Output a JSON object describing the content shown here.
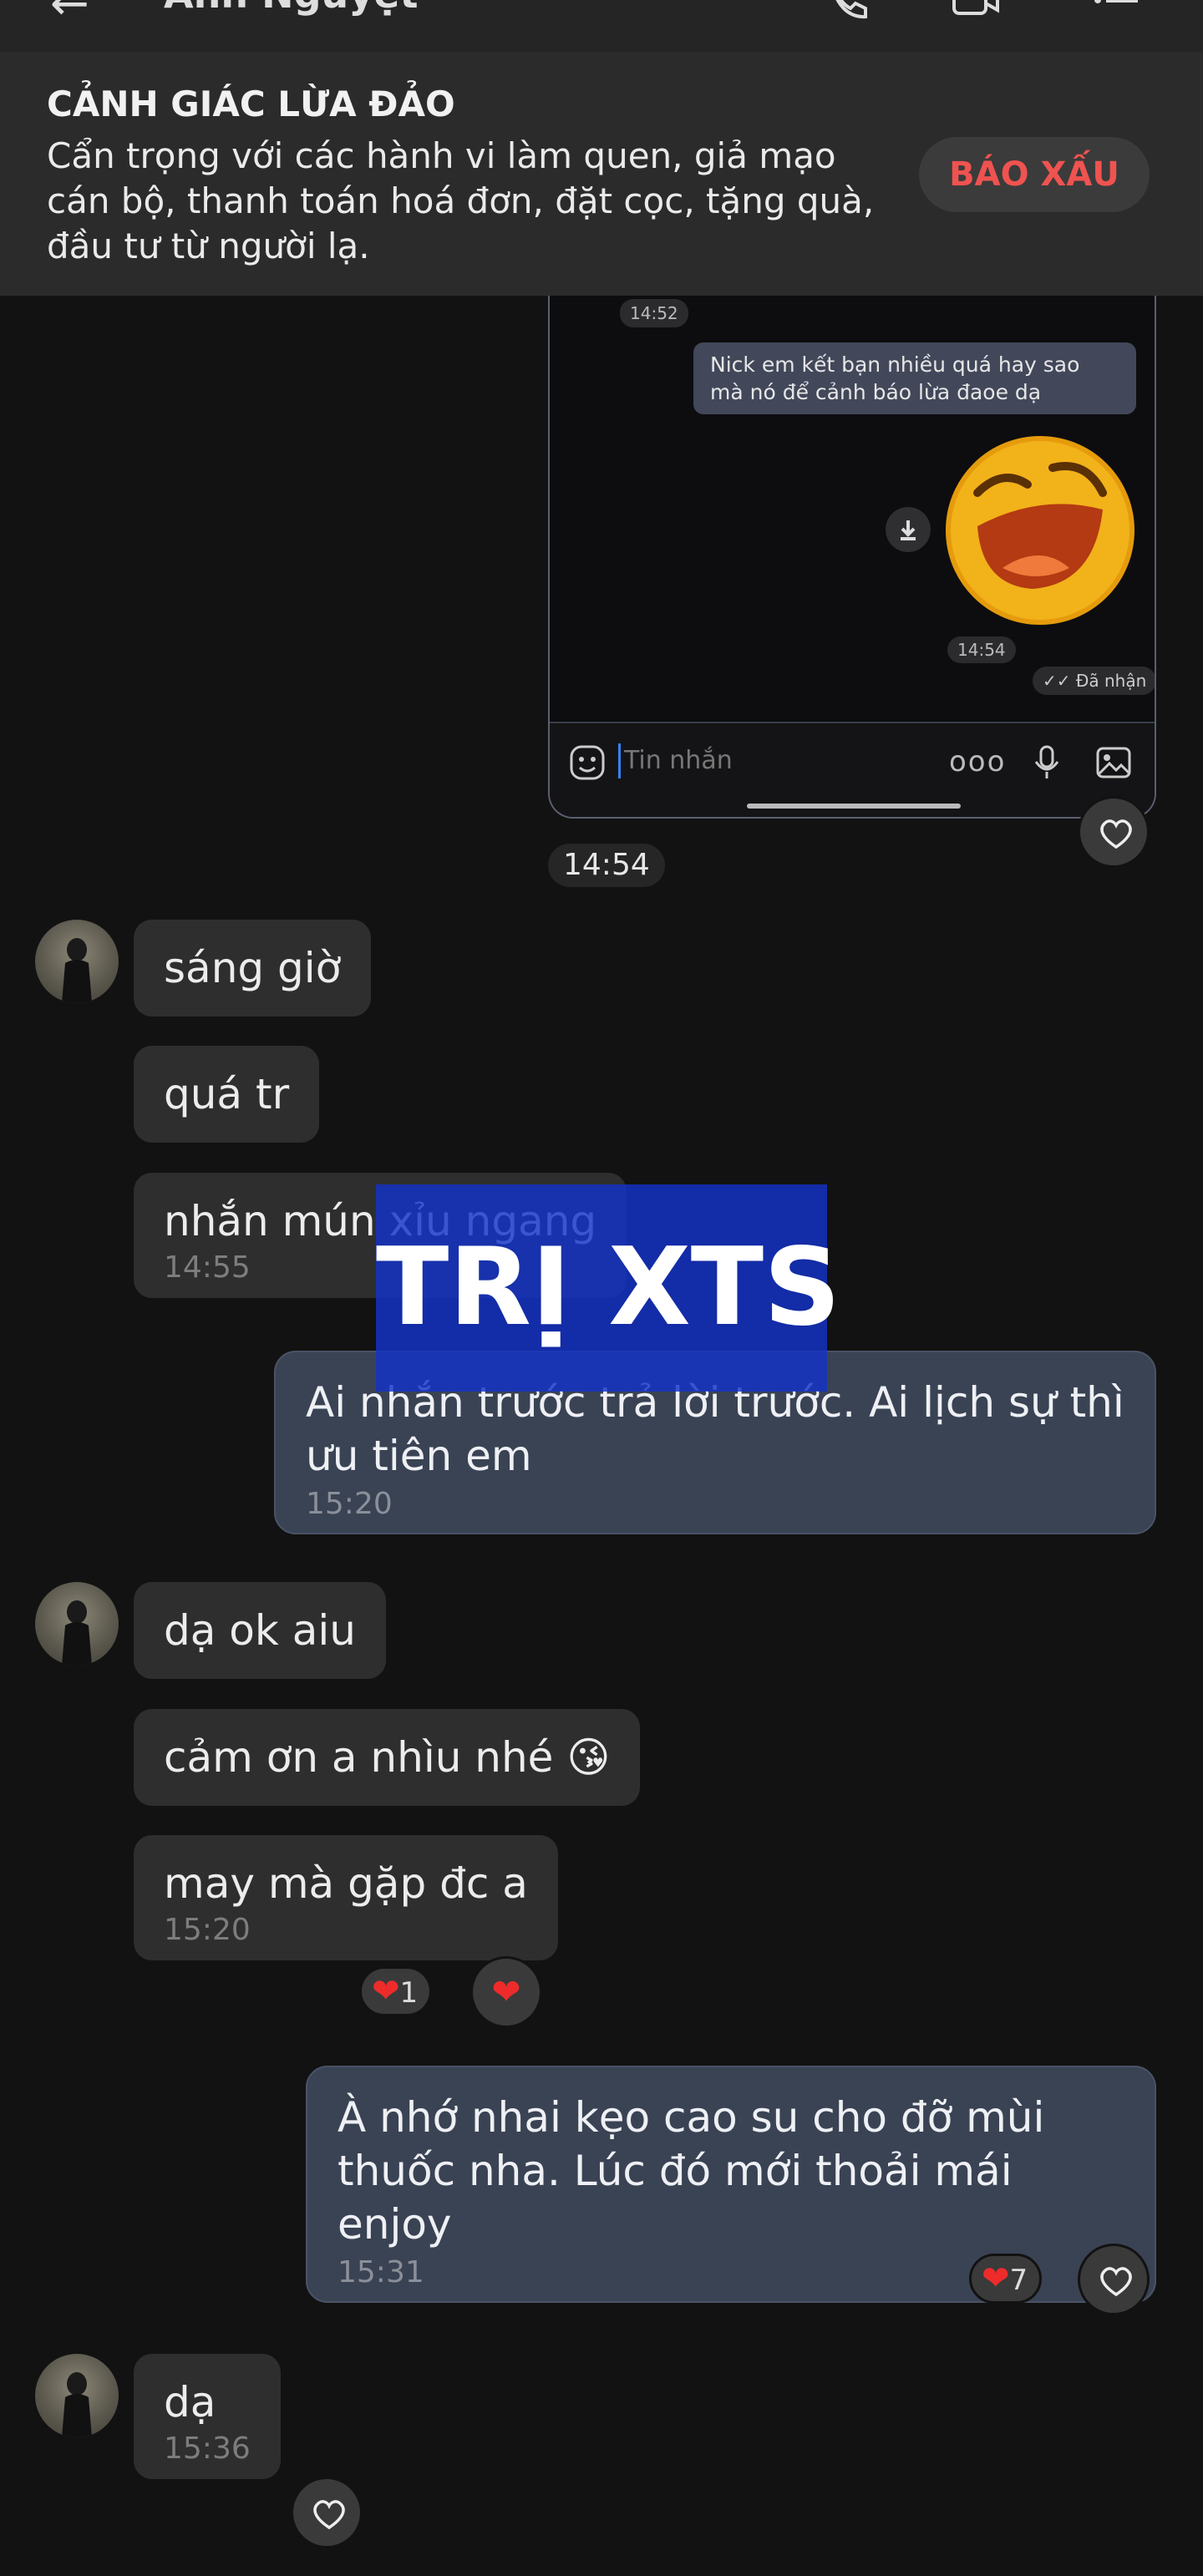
{
  "header": {
    "contact_name": "Anh Nguyệt"
  },
  "banner": {
    "title": "CẢNH GIÁC LỪA ĐẢO",
    "text": "Cẩn trọng với các hành vi làm quen, giả mạo cán bộ, thanh toán hoá đơn, đặt cọc, tặng quà, đầu tư từ người lạ.",
    "report_button": "BÁO XẤU"
  },
  "screenshot_image": {
    "time_top": "14:52",
    "message": "Nick em kết bạn nhiều quá hay sao mà nó để cảnh báo lừa đaoe dạ",
    "time_bottom": "14:54",
    "status": "✓✓ Đã nhận",
    "input_placeholder": "Tin nhắn",
    "more_glyph": "ooo"
  },
  "time_chip_1": "14:54",
  "messages": {
    "in1_text": "sáng giờ",
    "in2_text": "quá tr",
    "in3_text": "nhắn mún xỉu ngang",
    "in3_time": "14:55",
    "out1_text": "Ai nhắn trước trả lời trước. Ai lịch sự thì ưu tiên em",
    "out1_time": "15:20",
    "in4_text": "dạ ok aiu",
    "in5_text": "cảm ơn a nhìu nhé 😘",
    "in6_text": "may mà gặp đc a",
    "in6_time": "15:20",
    "in6_reaction_count": "1",
    "out2_text": "À nhớ nhai kẹo cao su cho đỡ mùi thuốc nha. Lúc đó mới thoải mái enjoy",
    "out2_time": "15:31",
    "out2_reaction_count": "7",
    "in7_text": "dạ",
    "in7_time": "15:36"
  },
  "watermark": "TRỊ XTS",
  "colors": {
    "background": "#121212",
    "incoming_bubble": "#2e2e2e",
    "outgoing_bubble": "#3a4354",
    "report_red": "#ef5350",
    "heart_red": "#ee2b2b",
    "watermark_blue": "#1432c8"
  }
}
